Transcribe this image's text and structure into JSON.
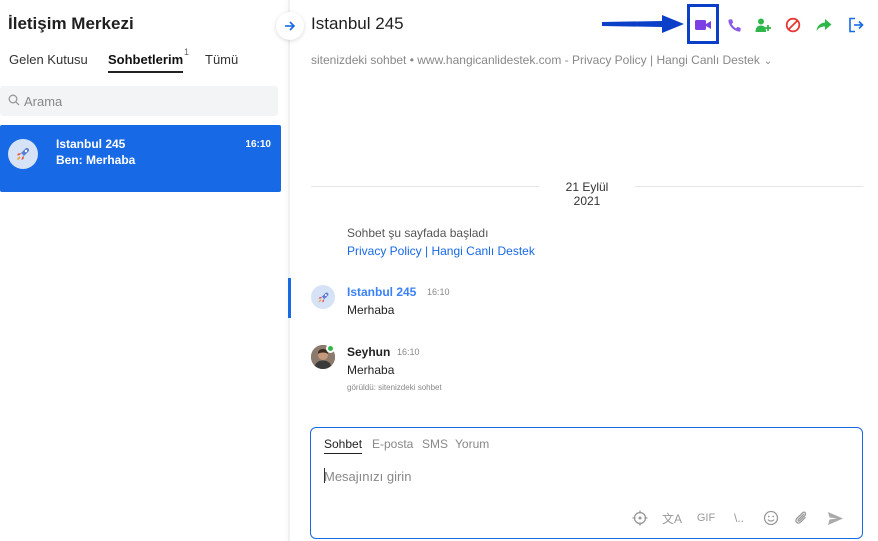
{
  "sidebar": {
    "title": "İletişim Merkezi",
    "tabs": [
      {
        "label": "Gelen Kutusu"
      },
      {
        "label": "Sohbetlerim",
        "badge": "1"
      },
      {
        "label": "Tümü"
      }
    ],
    "search_placeholder": "Arama",
    "conversations": [
      {
        "name": "Istanbul 245",
        "last_message": "Ben: Merhaba",
        "time": "16:10",
        "icon": "rocket-icon"
      }
    ]
  },
  "header": {
    "title": "Istanbul 245",
    "subtitle": "sitenizdeki sohbet • www.hangicanlidestek.com - Privacy Policy | Hangi Canlı Destek",
    "actions": [
      {
        "name": "video-call-icon",
        "color": "#7b3fe4"
      },
      {
        "name": "phone-icon",
        "color": "#8a5ae6"
      },
      {
        "name": "add-user-icon",
        "color": "#2fb84a"
      },
      {
        "name": "block-icon",
        "color": "#e53935"
      },
      {
        "name": "forward-icon",
        "color": "#2fb84a"
      },
      {
        "name": "exit-icon",
        "color": "#1769e6"
      }
    ]
  },
  "messages": {
    "date": "21 Eylül 2021",
    "system_text": "Sohbet şu sayfada başladı",
    "system_link": "Privacy Policy | Hangi Canlı Destek",
    "items": [
      {
        "author": "Istanbul 245",
        "time": "16:10",
        "text": "Merhaba",
        "author_color": "#3b82f6"
      },
      {
        "author": "Seyhun",
        "time": "16:10",
        "text": "Merhaba",
        "seen": "görüldü: sitenizdeki sohbet",
        "author_color": "#222222"
      }
    ]
  },
  "composer": {
    "tabs": [
      {
        "label": "Sohbet"
      },
      {
        "label": "E-posta"
      },
      {
        "label": "SMS"
      },
      {
        "label": "Yorum"
      }
    ],
    "placeholder": "Mesajınızı girin",
    "tools": [
      {
        "name": "target-icon"
      },
      {
        "name": "translate-icon",
        "label": "文A"
      },
      {
        "name": "gif-button",
        "label": "GIF"
      },
      {
        "name": "shortcut-icon",
        "label": "\\.."
      },
      {
        "name": "emoji-icon"
      },
      {
        "name": "attach-icon"
      },
      {
        "name": "send-icon"
      }
    ]
  },
  "colors": {
    "accent": "#1769e6",
    "highlight": "#0b3fc8"
  }
}
